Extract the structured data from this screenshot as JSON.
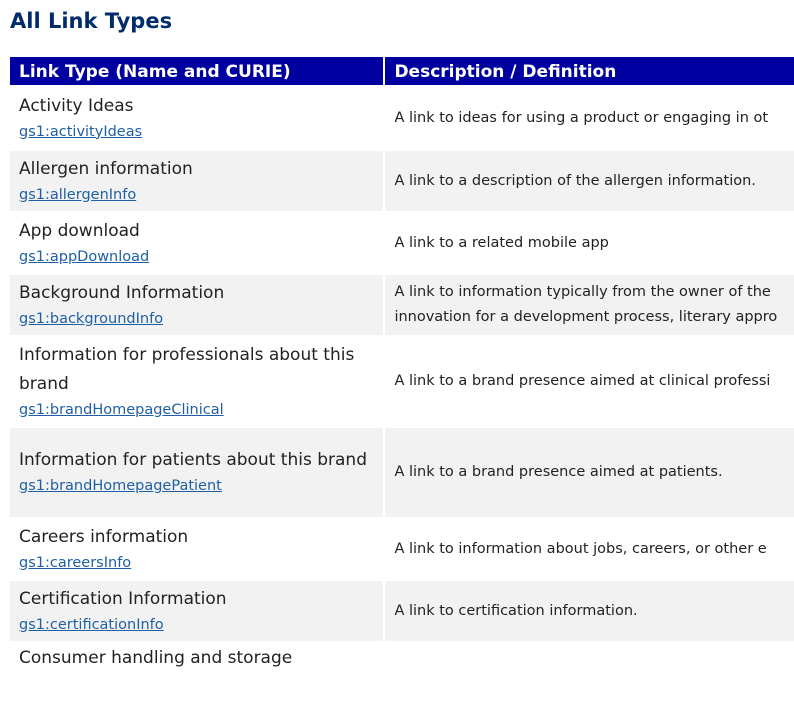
{
  "page": {
    "title": "All Link Types"
  },
  "table": {
    "headers": [
      "Link Type (Name and CURIE)",
      "Description / Definition"
    ],
    "rows": [
      {
        "name": "Activity Ideas",
        "curie": "gs1:activityIdeas",
        "description": "A link to ideas for using a product or engaging in ot"
      },
      {
        "name": "Allergen information",
        "curie": "gs1:allergenInfo",
        "description": "A link to a description of the allergen information."
      },
      {
        "name": "App download",
        "curie": "gs1:appDownload",
        "description": "A link to a related mobile app"
      },
      {
        "name": "Background Information",
        "curie": "gs1:backgroundInfo",
        "description": "A link to information typically from the owner of the",
        "description2": "innovation for a development process, literary appro"
      },
      {
        "name": "Information for professionals about this brand",
        "curie": "gs1:brandHomepageClinical",
        "description": "A link to a brand presence aimed at clinical professi"
      },
      {
        "name": "Information for patients about this brand",
        "curie": "gs1:brandHomepagePatient",
        "description": "A link to a brand presence aimed at patients."
      },
      {
        "name": "Careers information",
        "curie": "gs1:careersInfo",
        "description": "A link to information about jobs, careers, or other e"
      },
      {
        "name": "Certification Information",
        "curie": "gs1:certificationInfo",
        "description": "A link to certification information."
      },
      {
        "name": "Consumer handling and storage",
        "curie": "",
        "description": ""
      }
    ]
  }
}
